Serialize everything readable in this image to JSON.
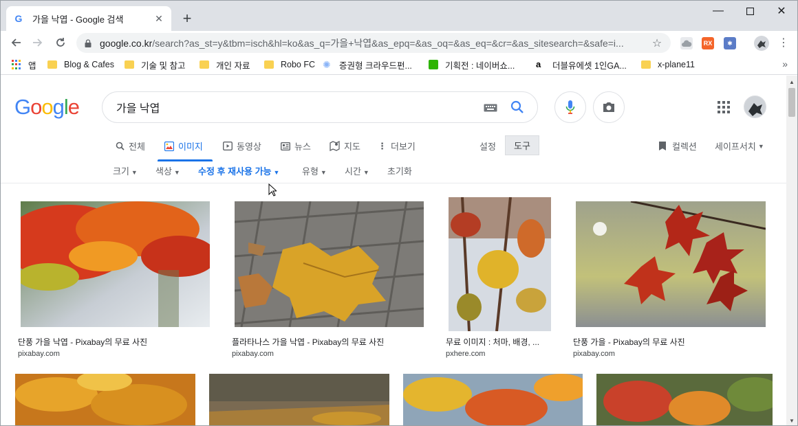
{
  "browser": {
    "tab_title": "가을 낙엽 - Google 검색",
    "tab_favicon": "G",
    "url_host": "google.co.kr",
    "url_path": "/search?as_st=y&tbm=isch&hl=ko&as_q=가을+낙엽&as_epq=&as_oq=&as_eq=&cr=&as_sitesearch=&safe=i..."
  },
  "bookmarks": [
    {
      "label": "앱",
      "icon": "apps-grid-icon"
    },
    {
      "label": "Blog & Cafes",
      "icon": "folder-icon"
    },
    {
      "label": "기술 및 참고",
      "icon": "folder-icon"
    },
    {
      "label": "개인 자료",
      "icon": "folder-icon"
    },
    {
      "label": "Robo FC",
      "icon": "folder-icon"
    },
    {
      "label": "증권형 크라우드펀...",
      "icon": "sparkle-icon"
    },
    {
      "label": "기획전 : 네이버쇼...",
      "icon": "green-square-icon"
    },
    {
      "label": "더블유에셋 1인GA...",
      "icon": "letter-a-icon"
    },
    {
      "label": "x-plane11",
      "icon": "folder-icon"
    }
  ],
  "search": {
    "query": "가을 낙엽"
  },
  "tabs": [
    {
      "label": "전체",
      "icon": "search-icon"
    },
    {
      "label": "이미지",
      "icon": "image-icon"
    },
    {
      "label": "동영상",
      "icon": "video-icon"
    },
    {
      "label": "뉴스",
      "icon": "news-icon"
    },
    {
      "label": "지도",
      "icon": "map-icon"
    },
    {
      "label": "더보기",
      "icon": "more-vert-icon"
    }
  ],
  "settings_label": "설정",
  "tools_label": "도구",
  "collections_label": "컬렉션",
  "safesearch_label": "세이프서치",
  "filters": [
    {
      "label": "크기"
    },
    {
      "label": "색상"
    },
    {
      "label": "수정 후 재사용 가능"
    },
    {
      "label": "유형"
    },
    {
      "label": "시간"
    },
    {
      "label": "초기화"
    }
  ],
  "results": [
    {
      "caption": "단풍 가을 낙엽 - Pixabay의 무료 사진",
      "source": "pixabay.com"
    },
    {
      "caption": "플라타나스 가을 낙엽 - Pixabay의 무료 사진",
      "source": "pixabay.com"
    },
    {
      "caption": "무료 이미지 : 처마, 배경, ...",
      "source": "pxhere.com"
    },
    {
      "caption": "단풍 가을 - Pixabay의 무료 사진",
      "source": "pixabay.com"
    }
  ],
  "colors": {
    "accent": "#1a73e8",
    "tab_strip": "#dee1e6",
    "omnibox": "#f1f3f4"
  }
}
